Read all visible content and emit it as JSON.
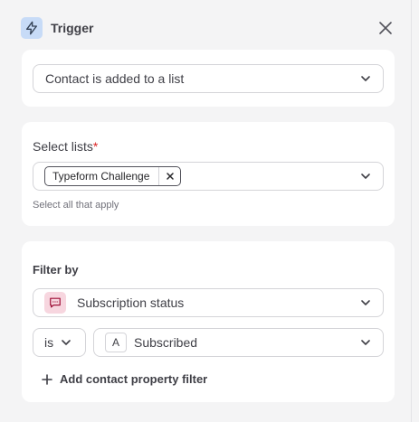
{
  "header": {
    "title": "Trigger",
    "icon": "lightning-icon",
    "close_icon": "close-icon",
    "badge_color": "#c7dbf7"
  },
  "trigger_event": {
    "selected": "Contact is added to a list"
  },
  "select_lists": {
    "label": "Select lists",
    "required_marker": "*",
    "chips": [
      "Typeform Challenge"
    ],
    "hint": "Select all that apply"
  },
  "filter": {
    "title": "Filter by",
    "property": {
      "label": "Subscription status",
      "icon": "chat-bubble-icon",
      "icon_bg": "#f7d6df"
    },
    "operator": "is",
    "value": {
      "type_glyph": "A",
      "label": "Subscribed"
    },
    "add_label": "Add contact property filter"
  },
  "colors": {
    "accent_required": "#dc2626",
    "background": "#f4f4f5",
    "card": "#ffffff"
  }
}
